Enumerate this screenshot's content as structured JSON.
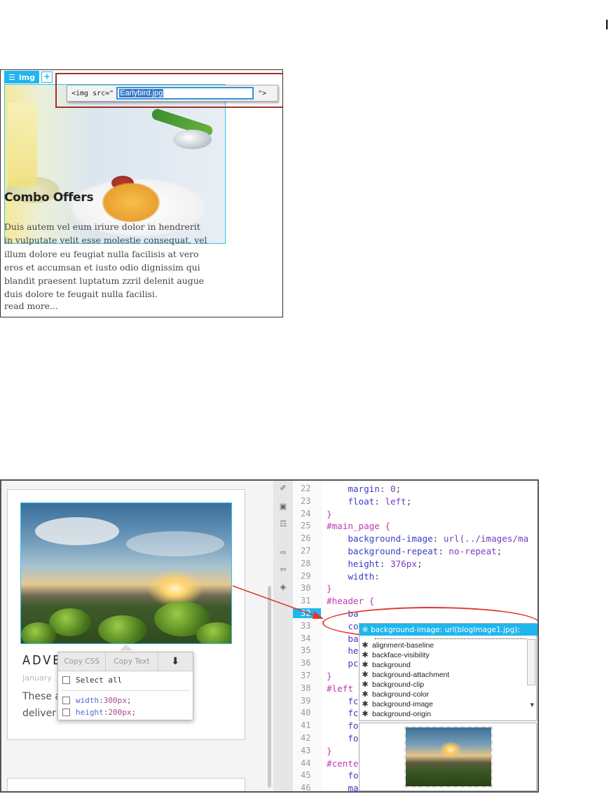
{
  "top_panel": {
    "tag_badge": "img",
    "plus": "+",
    "editor_prefix": "<img src=\"",
    "editor_value": "Earlybird.jpg",
    "editor_suffix": "\">",
    "title": "Combo Offers",
    "body_lines": [
      "Duis autem vel eum iriure dolor in hendrerit",
      "in vulputate velit esse molestie consequat, vel",
      "illum dolore eu feugiat nulla facilisis at vero",
      "eros et accumsan et iusto odio dignissim qui",
      "blandit praesent luptatum zzril delenit augue",
      "duis dolore te feugait nulla facilisi."
    ],
    "read_more": "read more..."
  },
  "bottom_panel": {
    "card_heading": "ADVEN",
    "card_date": "January",
    "excerpt_line1": "These a",
    "excerpt_line2": "deliver c",
    "copy_popup": {
      "copy_css": "Copy CSS",
      "copy_text": "Copy Text",
      "select_all": "Select all",
      "width_prop": "width",
      "width_val": "300px",
      "height_prop": "height",
      "height_val": "200px",
      "colon": ":",
      "semicolon": ";"
    },
    "line_numbers": [
      "22",
      "23",
      "24",
      "25",
      "26",
      "27",
      "28",
      "29",
      "30",
      "31",
      "32",
      "33",
      "34",
      "35",
      "36",
      "37",
      "38",
      "39",
      "40",
      "41",
      "42",
      "43",
      "44",
      "45",
      "46"
    ],
    "active_line": "32",
    "code_lines": [
      {
        "indent": "    ",
        "sel": "",
        "prop": "margin",
        "val": "0",
        "pun": ";"
      },
      {
        "indent": "    ",
        "sel": "",
        "prop": "float",
        "val": "left",
        "pun": ";"
      },
      {
        "indent": "",
        "sel": "}",
        "prop": "",
        "val": "",
        "pun": ""
      },
      {
        "indent": "",
        "sel": "#main_page {",
        "prop": "",
        "val": "",
        "pun": ""
      },
      {
        "indent": "    ",
        "sel": "",
        "prop": "background-image",
        "val": "url(../images/ma",
        "pun": ""
      },
      {
        "indent": "    ",
        "sel": "",
        "prop": "background-repeat",
        "val": "no-repeat",
        "pun": ";"
      },
      {
        "indent": "    ",
        "sel": "",
        "prop": "height",
        "val": "376px",
        "pun": ";"
      },
      {
        "indent": "    ",
        "sel": "",
        "prop": "width",
        "val": "",
        "pun": ":"
      },
      {
        "indent": "",
        "sel": "}",
        "prop": "",
        "val": "",
        "pun": ""
      },
      {
        "indent": "",
        "sel": "#header {",
        "prop": "",
        "val": "",
        "pun": ""
      },
      {
        "indent": "    ",
        "sel": "",
        "prop": "ba",
        "val": "",
        "pun": ""
      },
      {
        "indent": "    ",
        "sel": "",
        "prop": "co",
        "val": "",
        "pun": ""
      },
      {
        "indent": "    ",
        "sel": "",
        "prop": "ba",
        "val": "",
        "pun": ""
      },
      {
        "indent": "    ",
        "sel": "",
        "prop": "he",
        "val": "",
        "pun": ""
      },
      {
        "indent": "    ",
        "sel": "",
        "prop": "pc",
        "val": "",
        "pun": ""
      },
      {
        "indent": "",
        "sel": "}",
        "prop": "",
        "val": "",
        "pun": ""
      },
      {
        "indent": "",
        "sel": "#left",
        "prop": "",
        "val": "",
        "pun": ""
      },
      {
        "indent": "    ",
        "sel": "",
        "prop": "fc",
        "val": "",
        "pun": ""
      },
      {
        "indent": "    ",
        "sel": "",
        "prop": "fc",
        "val": "",
        "pun": ""
      },
      {
        "indent": "    ",
        "sel": "",
        "prop": "fo",
        "val": "",
        "pun": ""
      },
      {
        "indent": "    ",
        "sel": "",
        "prop": "fo",
        "val": "",
        "pun": ""
      },
      {
        "indent": "",
        "sel": "}",
        "prop": "",
        "val": "",
        "pun": ""
      },
      {
        "indent": "",
        "sel": "#cente",
        "prop": "",
        "val": "",
        "pun": ""
      },
      {
        "indent": "    ",
        "sel": "",
        "prop": "fo",
        "val": "",
        "pun": ""
      },
      {
        "indent": "    ",
        "sel": "",
        "prop": "margin",
        "val": "0px",
        "pun": ";"
      }
    ],
    "autocomplete": {
      "selected": "background-image: url(blogImage1.jpg);",
      "items": [
        "alignment-baseline",
        "backface-visibility",
        "background",
        "background-attachment",
        "background-clip",
        "background-color",
        "background-image",
        "background-origin"
      ]
    },
    "colors": {
      "accent": "#1fb6ee",
      "highlight_oval": "#e0362e",
      "selector": "#c03ab0",
      "property": "#3a3fc4"
    }
  }
}
